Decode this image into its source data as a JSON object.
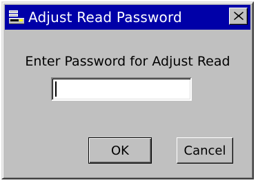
{
  "dialog": {
    "title": "Adjust Read Password",
    "title_icon": "app-icon",
    "close_icon": "close-icon",
    "prompt": "Enter Password for Adjust Read",
    "password_value": "",
    "ok_label": "OK",
    "cancel_label": "Cancel"
  },
  "colors": {
    "titlebar": "#0000a8",
    "title_text": "#ffffff",
    "dialog_face": "#c0c0c0",
    "input_bg": "#ffffff"
  }
}
